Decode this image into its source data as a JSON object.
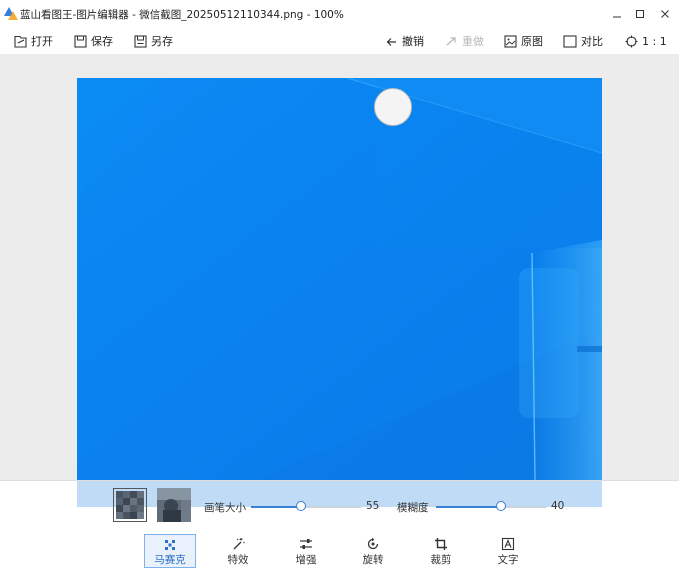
{
  "window": {
    "title": "蓝山看图王-图片编辑器 - 微信截图_20250512110344.png - 100%",
    "controls": [
      "minimize",
      "maximize",
      "close"
    ]
  },
  "toolbar": {
    "open_label": "打开",
    "save_label": "保存",
    "save_as_label": "另存",
    "undo_label": "撤销",
    "redo_label": "重做",
    "original_label": "原图",
    "compare_label": "对比",
    "ratio_label": "1 : 1",
    "redo_enabled": false
  },
  "mosaic": {
    "brush_label": "画笔大小",
    "brush_value": "55",
    "brush_level": 0.45,
    "blur_label": "模糊度",
    "blur_value": "40",
    "blur_level": 0.59,
    "selected_style": 0
  },
  "tools": [
    {
      "label": "马赛克",
      "icon": "mosaic-icon",
      "active": true
    },
    {
      "label": "特效",
      "icon": "magic-wand-icon",
      "active": false
    },
    {
      "label": "增强",
      "icon": "adjust-sliders-icon",
      "active": false
    },
    {
      "label": "旋转",
      "icon": "rotate-icon",
      "active": false
    },
    {
      "label": "裁剪",
      "icon": "crop-icon",
      "active": false
    },
    {
      "label": "文字",
      "icon": "text-icon",
      "active": false
    }
  ],
  "colors": {
    "accent": "#3a7fd6",
    "canvas_bg": "#ececec",
    "image_blue": "#0a86f0",
    "active_tool_bg": "#e9f2fc"
  }
}
